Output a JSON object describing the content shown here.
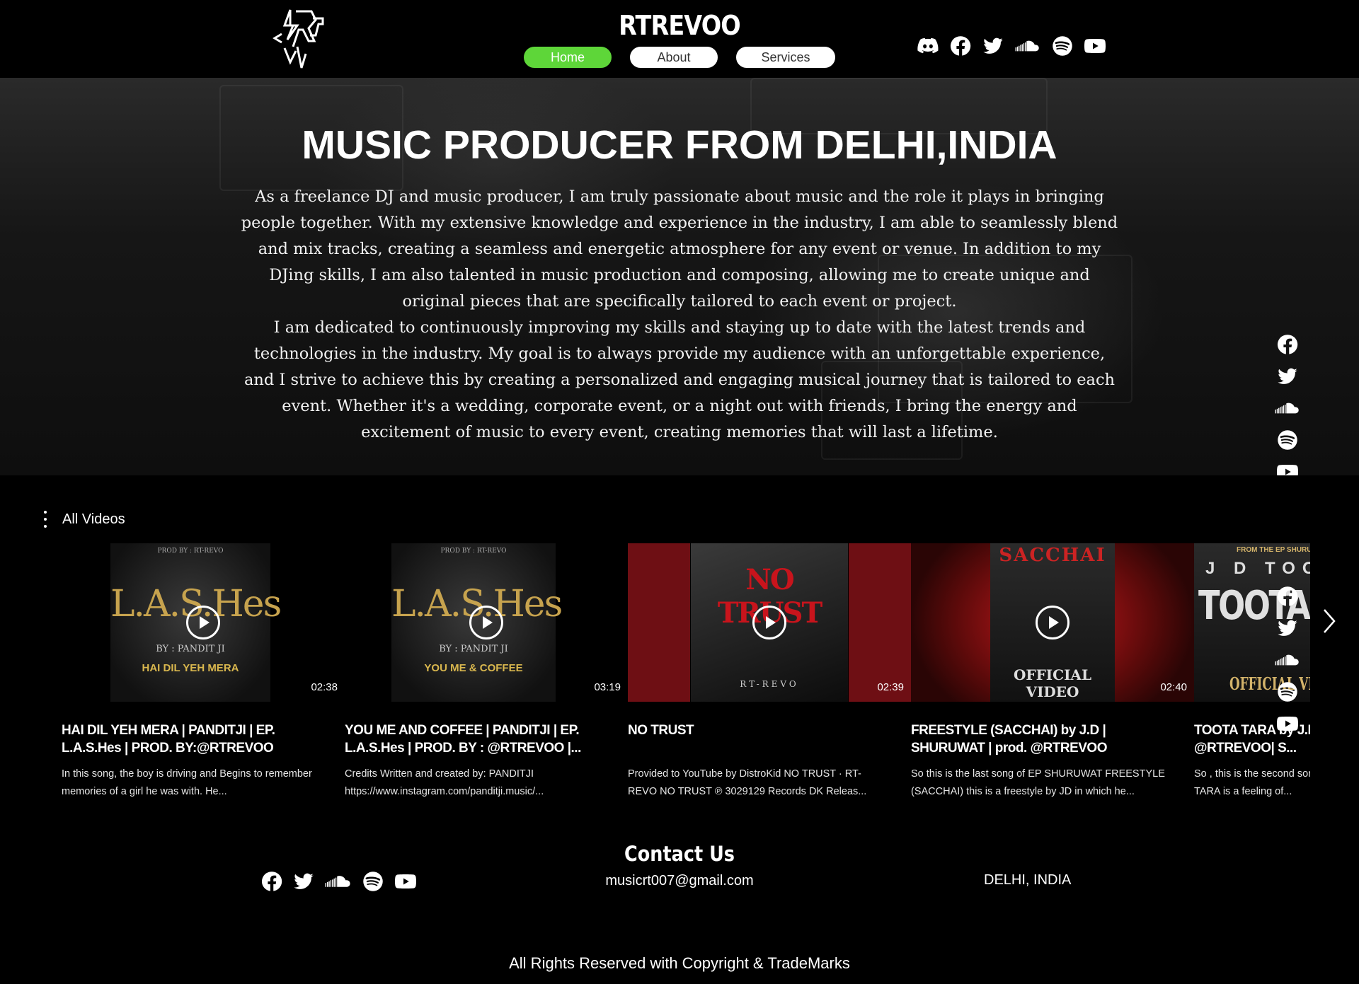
{
  "header": {
    "brand": "RTREVOO",
    "nav": [
      {
        "label": "Home",
        "active": true
      },
      {
        "label": "About",
        "active": false
      },
      {
        "label": "Services",
        "active": false
      }
    ],
    "social_icons": [
      "discord-icon",
      "facebook-icon",
      "twitter-icon",
      "soundcloud-icon",
      "spotify-icon",
      "youtube-icon"
    ]
  },
  "hero": {
    "title": "MUSIC PRODUCER FROM DELHI,INDIA",
    "paragraph1": "As a freelance DJ and music producer, I am truly passionate about music and the role it plays in bringing people together. With my extensive knowledge and experience in the industry, I am able to seamlessly blend and mix tracks, creating a seamless and energetic atmosphere for any event or venue. In addition to my DJing skills, I am also talented in music production and composing, allowing me to create unique and original pieces that are specifically tailored to each event or project.",
    "paragraph2": "I am dedicated to continuously improving my skills and staying up to date with the latest trends and technologies in the industry. My goal is to always provide my audience with an unforgettable experience, and I strive to achieve this by creating a personalized and engaging musical journey that is tailored to each event. Whether it's a wedding, corporate event, or a night out with friends, I bring the energy and excitement of music to every event, creating memories that will last a lifetime.",
    "side_social_icons": [
      "facebook-icon",
      "twitter-icon",
      "soundcloud-icon",
      "spotify-icon",
      "youtube-icon"
    ]
  },
  "videos": {
    "label": "All Videos",
    "items": [
      {
        "title": "HAI DIL YEH MERA | PANDITJI | EP. L.A.S.Hes | PROD. BY:@RTREVOO |FT.RD...",
        "description": "In this song, the boy is driving and Begins to remember memories of a girl he was with. He...",
        "duration": "02:38",
        "art": {
          "prod": "PROD BY : RT-REVO",
          "big": "L.A.S.Hes",
          "by": "BY : PANDIT JI",
          "song": "HAI DIL YEH MERA"
        }
      },
      {
        "title": "YOU ME AND COFFEE | PANDITJI | EP. L.A.S.Hes | PROD. BY : @RTREVOO |...",
        "description": "Credits Written and created by: PANDITJI https://www.instagram.com/panditji.music/...",
        "duration": "03:19",
        "art": {
          "prod": "PROD BY : RT-REVO",
          "big": "L.A.S.Hes",
          "by": "BY : PANDIT JI",
          "song": "YOU ME & COFFEE"
        }
      },
      {
        "title": "NO TRUST",
        "description": "Provided to YouTube by DistroKid NO TRUST · RT-REVO NO TRUST ℗ 3029129 Records DK Releas...",
        "duration": "02:39",
        "art": {
          "big": "NO TRUST",
          "by": "RT-REVO"
        }
      },
      {
        "title": "FREESTYLE (SACCHAI) by J.D | SHURUWAT | prod. @RTREVOO",
        "description": "So this is the last song of EP SHURUWAT FREESTYLE (SACCHAI) this is a freestyle by JD in which he...",
        "duration": "02:40",
        "art": {
          "big": "SACCHAI",
          "by": "OFFICIAL VIDEO"
        }
      },
      {
        "title": "TOOTA TARA by J.D | SHURUWAT | prod. @RTREVOO| S...",
        "description": "So , this is the second song of EP SHURUWAT. TOOTA TARA is a feeling of...",
        "duration": "",
        "art": {
          "ep": "FROM THE EP SHURUWAT",
          "jd": "J D TOOTA",
          "big": "TOOTA TARA",
          "by": "OFFICIAL VIDEO"
        }
      }
    ]
  },
  "contact": {
    "title": "Contact Us",
    "email": "musicrt007@gmail.com",
    "location": "DELHI, INDIA",
    "social_icons": [
      "facebook-icon",
      "twitter-icon",
      "soundcloud-icon",
      "spotify-icon",
      "youtube-icon"
    ]
  },
  "footer": {
    "copyright": "All Rights Reserved with Copyright & TradeMarks"
  },
  "colors": {
    "background": "#000000",
    "nav_active": "#5ed639",
    "text": "#ffffff"
  }
}
